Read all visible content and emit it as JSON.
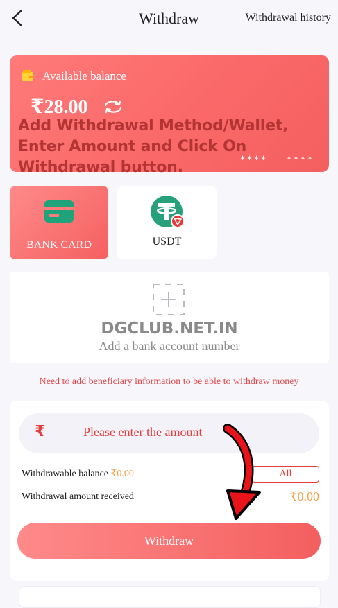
{
  "header": {
    "title": "Withdraw",
    "history_label": "Withdrawal history"
  },
  "balance": {
    "label": "Available balance",
    "amount": "₹28.00",
    "masked_left": "****",
    "masked_right": "****"
  },
  "overlay_text": "Add Withdrawal Method/Wallet, Enter Amount and Click On Withdrawal button.",
  "methods": [
    {
      "label": "BANK CARD",
      "selected": true,
      "icon": "bank-card-icon"
    },
    {
      "label": "USDT",
      "selected": false,
      "icon": "usdt-tron-icon"
    }
  ],
  "add_bank": {
    "watermark": "DGCLUB.NET.IN",
    "label": "Add a bank account number"
  },
  "warning": "Need to add beneficiary information to be able to withdraw money",
  "amount": {
    "currency_symbol": "₹",
    "placeholder": "Please enter the amount"
  },
  "withdrawable": {
    "label": "Withdrawable balance",
    "value": "₹0.00",
    "all_label": "All"
  },
  "received": {
    "label": "Withdrawal amount received",
    "value": "₹0.00"
  },
  "withdraw_button": "Withdraw",
  "colors": {
    "accent": "#f45f5f",
    "card_green": "#1fa37a",
    "usdt_teal": "#26a17b",
    "tron_red": "#e53935",
    "value_orange": "#f5a04a"
  }
}
